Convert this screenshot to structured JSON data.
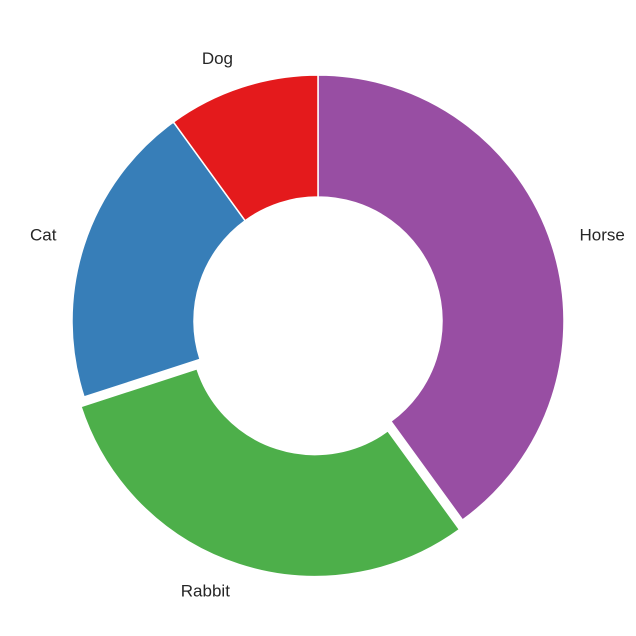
{
  "chart_data": {
    "type": "pie",
    "donut": true,
    "title": "",
    "categories": [
      "Horse",
      "Rabbit",
      "Cat",
      "Dog"
    ],
    "values": [
      40,
      30,
      20,
      10
    ],
    "colors": [
      "#984ea3",
      "#4daf4a",
      "#377eb8",
      "#e41a1c"
    ],
    "exploded": [
      "Rabbit"
    ],
    "start": "12 o'clock, clockwise",
    "legend": "none"
  }
}
